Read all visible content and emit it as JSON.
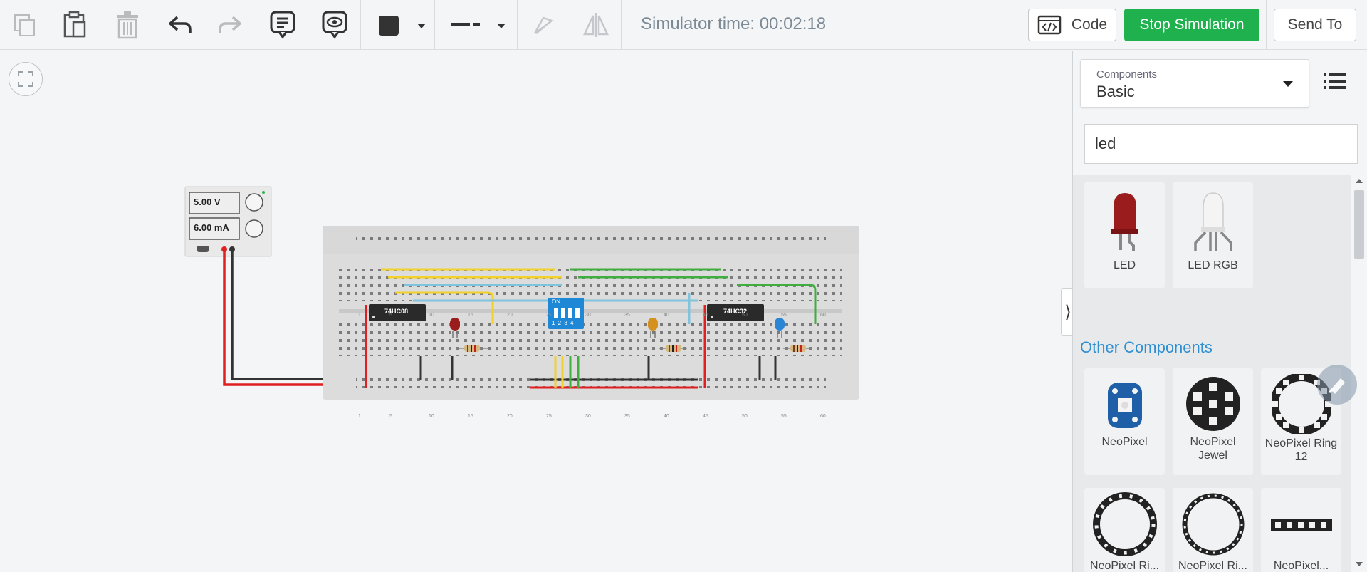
{
  "toolbar": {
    "simulator_time": "Simulator time: 00:02:18",
    "code_label": "Code",
    "stop_label": "Stop Simulation",
    "send_label": "Send To"
  },
  "power_supply": {
    "voltage": "5.00 V",
    "current": "6.00 mA"
  },
  "breadboard": {
    "chip_left": "74HC08",
    "chip_right": "74HC32",
    "dip_on": "ON",
    "dip_numbers": "1 2 3 4",
    "row_numbers": [
      "1",
      "5",
      "10",
      "15",
      "20",
      "25",
      "30",
      "35",
      "40",
      "45",
      "50",
      "55",
      "60"
    ]
  },
  "panel": {
    "components_label": "Components",
    "components_value": "Basic",
    "search_value": "led",
    "results": [
      {
        "label": "LED",
        "icon": "led-icon"
      },
      {
        "label": "LED RGB",
        "icon": "led-rgb-icon"
      }
    ],
    "other_title": "Other Components",
    "other": [
      {
        "label": "NeoPixel",
        "icon": "neopixel-icon"
      },
      {
        "label": "NeoPixel Jewel",
        "icon": "neopixel-jewel-icon"
      },
      {
        "label": "NeoPixel Ring 12",
        "icon": "neopixel-ring-12-icon"
      },
      {
        "label": "NeoPixel Ri...",
        "icon": "neopixel-ring-icon"
      },
      {
        "label": "NeoPixel Ri...",
        "icon": "neopixel-ring-icon"
      },
      {
        "label": "NeoPixel...",
        "icon": "neopixel-strip-icon"
      }
    ]
  },
  "colors": {
    "stop_green": "#1fb14d",
    "accent_blue": "#2f8fd1",
    "wire_red": "#e02020",
    "wire_black": "#333333",
    "wire_yellow": "#f2d12a",
    "wire_green": "#3fae3f",
    "wire_cyan": "#7fc4dc"
  }
}
